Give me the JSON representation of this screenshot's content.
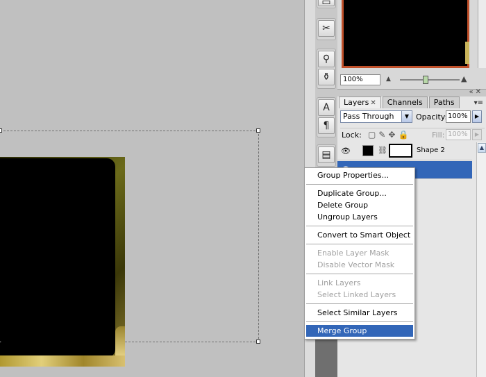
{
  "navigator": {
    "zoom_value": "100%",
    "zoom_out_icon": "small-mountain-icon",
    "zoom_in_icon": "large-mountain-icon"
  },
  "layers_panel": {
    "tabs": [
      {
        "label": "Layers",
        "active": true,
        "closable": true
      },
      {
        "label": "Channels",
        "active": false
      },
      {
        "label": "Paths",
        "active": false
      }
    ],
    "blend_mode": "Pass Through",
    "opacity_label": "Opacity:",
    "opacity_value": "100%",
    "lock_label": "Lock:",
    "fill_label": "Fill:",
    "fill_value": "100%",
    "layers": [
      {
        "name": "Shape 2",
        "visible": true,
        "selected": false
      },
      {
        "name": "",
        "visible": true,
        "selected": true
      }
    ]
  },
  "context_menu": {
    "groups": [
      [
        {
          "label": "Group Properties...",
          "enabled": true
        }
      ],
      [
        {
          "label": "Duplicate Group...",
          "enabled": true
        },
        {
          "label": "Delete Group",
          "enabled": true
        },
        {
          "label": "Ungroup Layers",
          "enabled": true
        }
      ],
      [
        {
          "label": "Convert to Smart Object",
          "enabled": true
        }
      ],
      [
        {
          "label": "Enable Layer Mask",
          "enabled": false
        },
        {
          "label": "Disable Vector Mask",
          "enabled": false
        }
      ],
      [
        {
          "label": "Link Layers",
          "enabled": false
        },
        {
          "label": "Select Linked Layers",
          "enabled": false
        }
      ],
      [
        {
          "label": "Select Similar Layers",
          "enabled": true
        }
      ],
      [
        {
          "label": "Merge Group",
          "enabled": true,
          "highlighted": true
        }
      ]
    ]
  },
  "colors": {
    "selection_blue": "#3266b8",
    "panel_gray": "#e6e6e6",
    "canvas_gray": "#c0c0c0",
    "navigator_frame": "#c0502a"
  }
}
